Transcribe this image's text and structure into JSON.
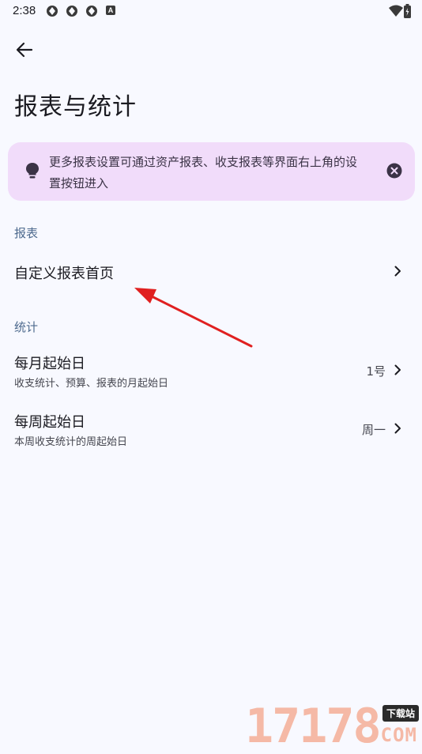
{
  "status_bar": {
    "time": "2:38",
    "icons": [
      "app-icon",
      "app-icon",
      "app-icon",
      "a-icon"
    ],
    "right_icons": [
      "wifi-icon",
      "battery-icon"
    ],
    "a_label": "A"
  },
  "header": {
    "back_icon": "arrow-left-icon",
    "title": "报表与统计"
  },
  "banner": {
    "icon": "lightbulb-icon",
    "text": "更多报表设置可通过资产报表、收支报表等界面右上角的设置按钮进入",
    "close_icon": "close-circle-icon",
    "background": "#f1dcfa"
  },
  "sections": {
    "report": {
      "header": "报表",
      "items": [
        {
          "title": "自定义报表首页"
        }
      ]
    },
    "stats": {
      "header": "统计",
      "items": [
        {
          "title": "每月起始日",
          "subtitle": "收支统计、预算、报表的月起始日",
          "value": "1号"
        },
        {
          "title": "每周起始日",
          "subtitle": "本周收支统计的周起始日",
          "value": "周一"
        }
      ]
    }
  },
  "annotation": {
    "type": "red-arrow",
    "color": "#e02020"
  },
  "watermark": {
    "number": "17178",
    "tag": "下载站",
    "domain": "COM"
  },
  "colors": {
    "background": "#f8f9ff",
    "section_header": "#4e6a8e",
    "text_primary": "#1b1b21",
    "text_secondary": "#45464f"
  }
}
